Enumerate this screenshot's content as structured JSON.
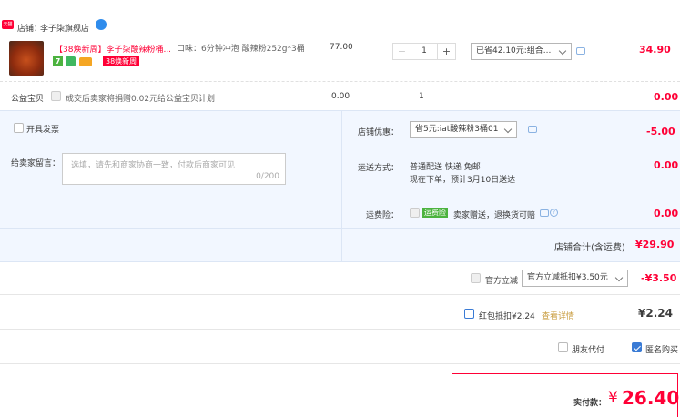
{
  "store": {
    "icon_label": "天猫",
    "label": "店铺：",
    "name": "李子柒旗舰店"
  },
  "item": {
    "title": "【38焕新周】李子柒酸辣粉桶...",
    "tags": [
      "7",
      "38焕新周"
    ],
    "spec": "口味：6分钟冲泡 酸辣粉252g*3桶",
    "price": "77.00",
    "qty": "1",
    "qty_minus": "−",
    "qty_plus": "+",
    "discount_select": "已省42.10元:组合...",
    "total": "34.90"
  },
  "charity": {
    "label": "公益宝贝",
    "desc": "成交后卖家将捐赠0.02元给公益宝贝计划",
    "price": "0.00",
    "qty": "1",
    "total": "0.00"
  },
  "invoice": {
    "label": "开具发票"
  },
  "message": {
    "label": "给卖家留言：",
    "placeholder": "选填，请先和商家协商一致，付款后商家可见",
    "counter": "0/200"
  },
  "shop_discount": {
    "label": "店铺优惠：",
    "select": "省5元:iat酸辣粉3桶01",
    "amount": "-5.00"
  },
  "delivery": {
    "label": "运送方式：",
    "line1": "普通配送 快递 免邮",
    "line2": "现在下单，预计3月10日送达",
    "amount": "0.00"
  },
  "insurance": {
    "label": "运费险：",
    "badge": "运费险",
    "desc": "卖家赠送，退换货可赔",
    "amount": "0.00"
  },
  "shop_total": {
    "label": "店铺合计(含运费)",
    "amount": "¥29.90"
  },
  "official_discount": {
    "label": "官方立减",
    "select": "官方立减抵扣¥3.50元",
    "amount": "-¥3.50"
  },
  "red_packet": {
    "label": "红包抵扣¥2.24",
    "link": "查看详情",
    "amount": "¥2.24"
  },
  "options": {
    "friend_pay": "朋友代付",
    "anonymous": "匿名购买"
  },
  "payment": {
    "label": "实付款：",
    "currency": "¥",
    "amount": "26.40"
  },
  "colors": {
    "accent_red": "#ff0036",
    "blue": "#3a7bd5",
    "section_bg": "#f2f7ff"
  }
}
